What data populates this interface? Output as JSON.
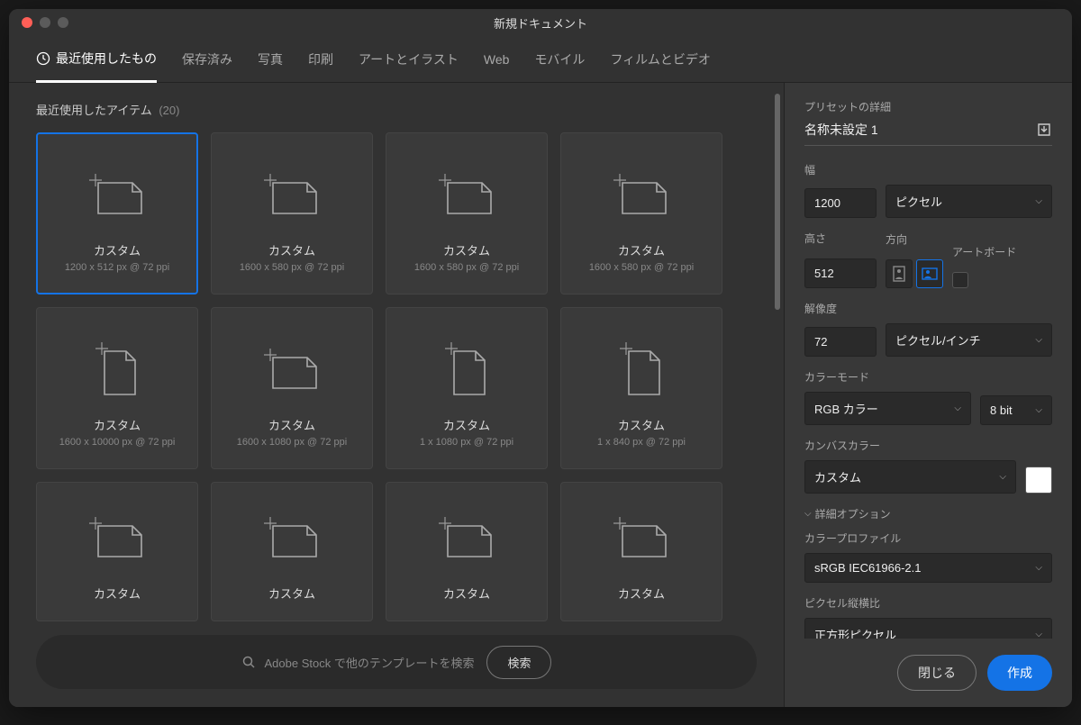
{
  "window": {
    "title": "新規ドキュメント"
  },
  "tabs": [
    {
      "label": "最近使用したもの",
      "active": true,
      "icon": true
    },
    {
      "label": "保存済み"
    },
    {
      "label": "写真"
    },
    {
      "label": "印刷"
    },
    {
      "label": "アートとイラスト"
    },
    {
      "label": "Web"
    },
    {
      "label": "モバイル"
    },
    {
      "label": "フィルムとビデオ"
    }
  ],
  "recent": {
    "header": "最近使用したアイテム",
    "count": "(20)",
    "items": [
      {
        "label": "カスタム",
        "dims": "1200 x 512 px @ 72 ppi",
        "selected": true,
        "shape": "landscape"
      },
      {
        "label": "カスタム",
        "dims": "1600 x 580 px @ 72 ppi",
        "shape": "landscape"
      },
      {
        "label": "カスタム",
        "dims": "1600 x 580 px @ 72 ppi",
        "shape": "landscape"
      },
      {
        "label": "カスタム",
        "dims": "1600 x 580 px @ 72 ppi",
        "shape": "landscape"
      },
      {
        "label": "カスタム",
        "dims": "1600 x 10000 px @ 72 ppi",
        "shape": "portrait"
      },
      {
        "label": "カスタム",
        "dims": "1600 x 1080 px @ 72 ppi",
        "shape": "landscape"
      },
      {
        "label": "カスタム",
        "dims": "1 x 1080 px @ 72 ppi",
        "shape": "portrait"
      },
      {
        "label": "カスタム",
        "dims": "1 x 840 px @ 72 ppi",
        "shape": "portrait"
      },
      {
        "label": "カスタム",
        "dims": "",
        "shape": "landscape"
      },
      {
        "label": "カスタム",
        "dims": "",
        "shape": "landscape"
      },
      {
        "label": "カスタム",
        "dims": "",
        "shape": "landscape"
      },
      {
        "label": "カスタム",
        "dims": "",
        "shape": "landscape"
      }
    ]
  },
  "search": {
    "placeholder": "Adobe Stock で他のテンプレートを検索",
    "button": "検索"
  },
  "preset": {
    "header": "プリセットの詳細",
    "name": "名称未設定 1",
    "width_label": "幅",
    "width": "1200",
    "unit": "ピクセル",
    "height_label": "高さ",
    "height": "512",
    "orientation_label": "方向",
    "artboard_label": "アートボード",
    "resolution_label": "解像度",
    "resolution": "72",
    "resolution_unit": "ピクセル/インチ",
    "color_mode_label": "カラーモード",
    "color_mode": "RGB カラー",
    "bit_depth": "8 bit",
    "bg_label": "カンバスカラー",
    "bg_value": "カスタム",
    "advanced": "詳細オプション",
    "profile_label": "カラープロファイル",
    "profile": "sRGB IEC61966-2.1",
    "aspect_label": "ピクセル縦横比",
    "aspect": "正方形ピクセル"
  },
  "footer": {
    "close": "閉じる",
    "create": "作成"
  }
}
